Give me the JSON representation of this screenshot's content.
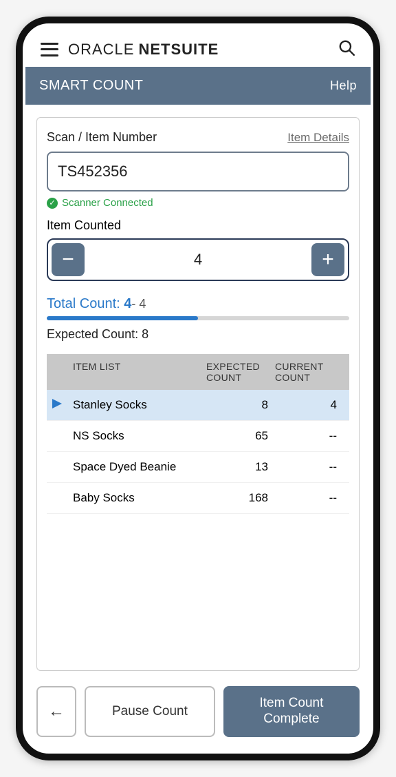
{
  "brand": {
    "word1": "ORACLE",
    "word2": "NETSUITE"
  },
  "page": {
    "title": "SMART COUNT",
    "help": "Help"
  },
  "scan": {
    "label": "Scan / Item Number",
    "details_link": "Item Details",
    "value": "TS452356",
    "scanner_status": "Scanner Connected"
  },
  "counter": {
    "label": "Item Counted",
    "value": "4"
  },
  "totals": {
    "total_label": "Total Count:",
    "total_value": "4",
    "diff": "- 4",
    "progress_percent": 50,
    "expected_label": "Expected Count:",
    "expected_value": "8"
  },
  "table": {
    "headers": {
      "item": "ITEM LIST",
      "expected": "EXPECTED COUNT",
      "current": "CURRENT COUNT"
    },
    "rows": [
      {
        "name": "Stanley Socks",
        "expected": "8",
        "current": "4",
        "active": true
      },
      {
        "name": "NS Socks",
        "expected": "65",
        "current": "--",
        "active": false
      },
      {
        "name": "Space Dyed Beanie",
        "expected": "13",
        "current": "--",
        "active": false
      },
      {
        "name": "Baby Socks",
        "expected": "168",
        "current": "--",
        "active": false
      }
    ]
  },
  "footer": {
    "pause": "Pause Count",
    "complete": "Item Count Complete"
  }
}
